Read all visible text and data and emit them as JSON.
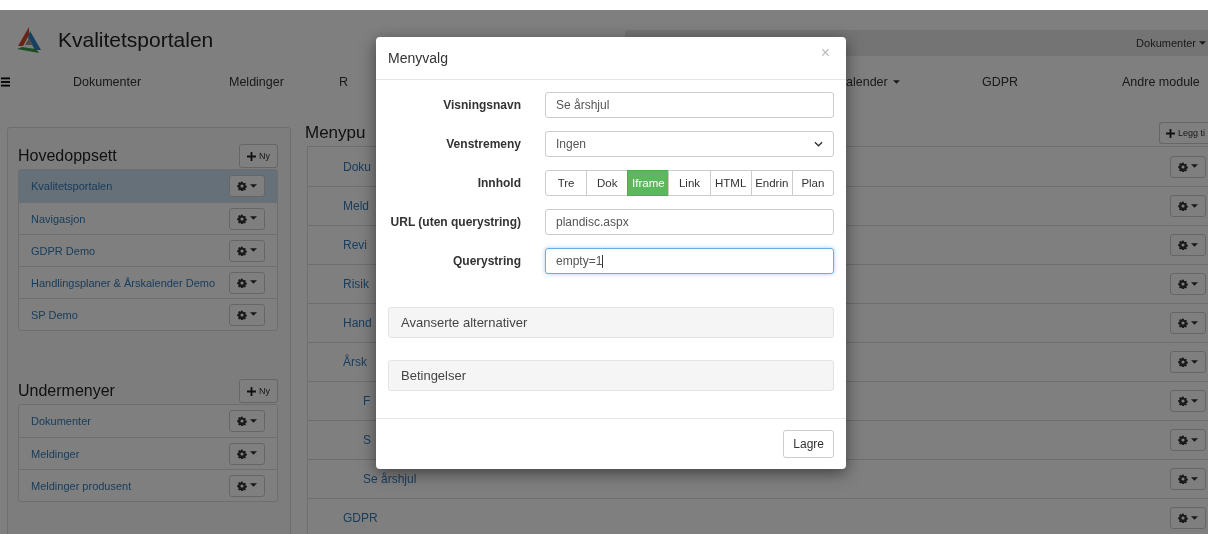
{
  "header": {
    "title": "Kvalitetsportalen",
    "top_menu": {
      "label": "Dokumenter",
      "dropdown": true
    }
  },
  "nav": [
    {
      "label": "Dokumenter",
      "dropdown": false
    },
    {
      "label": "Meldinger",
      "dropdown": false
    },
    {
      "label": "R",
      "dropdown": false
    },
    {
      "label": "alender",
      "dropdown": true
    },
    {
      "label": "GDPR",
      "dropdown": false
    },
    {
      "label": "Andre module",
      "dropdown": false
    }
  ],
  "sidebar": {
    "sections": [
      {
        "title": "Hovedoppsett",
        "new_button": "Ny",
        "items": [
          {
            "label": "Kvalitetsportalen",
            "selected": true
          },
          {
            "label": "Navigasjon",
            "selected": false
          },
          {
            "label": "GDPR Demo",
            "selected": false
          },
          {
            "label": "Handlingsplaner & Årskalender Demo",
            "selected": false
          },
          {
            "label": "SP Demo",
            "selected": false
          }
        ]
      },
      {
        "title": "Undermenyer",
        "new_button": "Ny",
        "items": [
          {
            "label": "Dokumenter",
            "selected": false
          },
          {
            "label": "Meldinger",
            "selected": false
          },
          {
            "label": "Meldinger produsent",
            "selected": false
          }
        ]
      }
    ]
  },
  "menu_items": {
    "title": "Menypu",
    "add_button": "Legg ti",
    "rows": [
      {
        "label": "Doku"
      },
      {
        "label": "Meld"
      },
      {
        "label": "Revi"
      },
      {
        "label": "Risik"
      },
      {
        "label": "Hand"
      },
      {
        "label": "Årsk"
      },
      {
        "label": "F",
        "indented": true
      },
      {
        "label": "S",
        "indented": true
      },
      {
        "label": "Se årshjul",
        "indented": true
      },
      {
        "label": "GDPR"
      }
    ]
  },
  "dialog": {
    "title": "Menyvalg",
    "close": "×",
    "fields": [
      {
        "kind": "text",
        "label": "Visningsnavn",
        "value": "Se årshjul",
        "focused": false
      },
      {
        "kind": "select",
        "label": "Venstremeny",
        "value": "Ingen"
      },
      {
        "kind": "segmented",
        "label": "Innhold",
        "options": [
          {
            "label": "Tre",
            "selected": false
          },
          {
            "label": "Dok",
            "selected": false
          },
          {
            "label": "Iframe",
            "selected": true
          },
          {
            "label": "Link",
            "selected": false
          },
          {
            "label": "HTML",
            "selected": false
          },
          {
            "label": "Endrin",
            "selected": false
          },
          {
            "label": "Plan",
            "selected": false
          }
        ]
      },
      {
        "kind": "text",
        "label": "URL (uten querystring)",
        "value": "plandisc.aspx",
        "focused": false
      },
      {
        "kind": "text",
        "label": "Querystring",
        "value": "empty=1",
        "focused": true
      }
    ],
    "panels": [
      "Avanserte alternativer",
      "Betingelser"
    ],
    "save_button": "Lagre"
  }
}
